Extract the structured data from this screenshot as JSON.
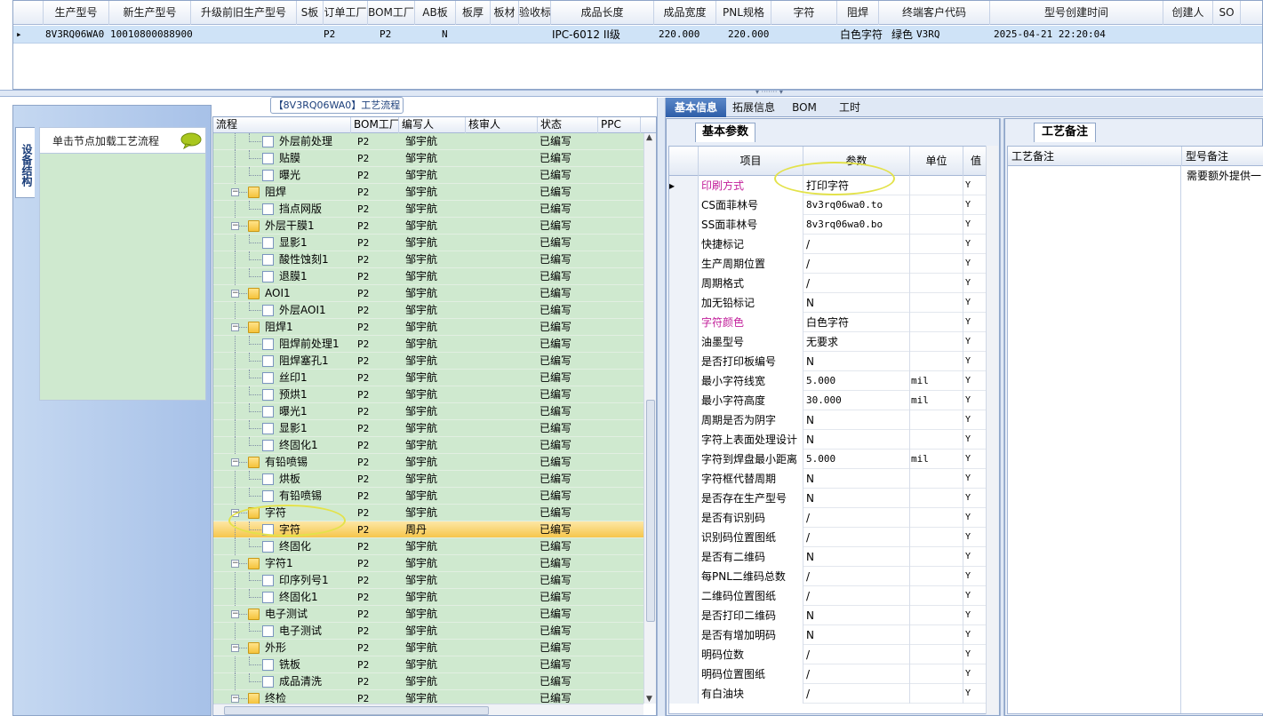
{
  "top_grid": {
    "headers": [
      "生产型号",
      "新生产型号",
      "升级前旧生产型号",
      "S板",
      "订单工厂",
      "BOM工厂",
      "AB板",
      "板厚",
      "板材",
      "验收标准",
      "成品长度",
      "成品宽度",
      "PNL规格",
      "字符",
      "阻焊",
      "终端客户代码",
      "型号创建时间",
      "创建人",
      "SO"
    ],
    "row": {
      "pointer": "▸",
      "model": "8V3RQ06WA0",
      "new_model": "10010800088900",
      "order_factory": "P2",
      "bom_factory": "P2",
      "ab_board": "N",
      "standard": "IPC-6012 II级",
      "length": "220.000",
      "width": "220.000",
      "char": "白色字符",
      "solder": "绿色",
      "customer": "V3RQ",
      "created": "2025-04-21 22:20:04"
    }
  },
  "left_panel": {
    "vertical_tab": "设备结构",
    "hint": "单击节点加载工艺流程"
  },
  "flow": {
    "title": "【8V3RQ06WA0】工艺流程",
    "headers": [
      "流程",
      "BOM工厂",
      "编写人",
      "核审人",
      "状态",
      "PPC"
    ],
    "rows": [
      {
        "level": 2,
        "type": "doc",
        "name": "外层前处理",
        "bom": "P2",
        "writer": "邹宇航",
        "status": "已编写"
      },
      {
        "level": 2,
        "type": "doc",
        "name": "贴膜",
        "bom": "P2",
        "writer": "邹宇航",
        "status": "已编写"
      },
      {
        "level": 2,
        "type": "doc",
        "name": "曝光",
        "bom": "P2",
        "writer": "邹宇航",
        "status": "已编写"
      },
      {
        "level": 1,
        "type": "folder",
        "name": "阻焊",
        "bom": "P2",
        "writer": "邹宇航",
        "status": "已编写"
      },
      {
        "level": 2,
        "type": "doc",
        "name": "挡点网版",
        "bom": "P2",
        "writer": "邹宇航",
        "status": "已编写"
      },
      {
        "level": 1,
        "type": "folder",
        "name": "外层干膜1",
        "bom": "P2",
        "writer": "邹宇航",
        "status": "已编写"
      },
      {
        "level": 2,
        "type": "doc",
        "name": "显影1",
        "bom": "P2",
        "writer": "邹宇航",
        "status": "已编写"
      },
      {
        "level": 2,
        "type": "doc",
        "name": "酸性蚀刻1",
        "bom": "P2",
        "writer": "邹宇航",
        "status": "已编写"
      },
      {
        "level": 2,
        "type": "doc",
        "name": "退膜1",
        "bom": "P2",
        "writer": "邹宇航",
        "status": "已编写"
      },
      {
        "level": 1,
        "type": "folder",
        "name": "AOI1",
        "bom": "P2",
        "writer": "邹宇航",
        "status": "已编写"
      },
      {
        "level": 2,
        "type": "doc",
        "name": "外层AOI1",
        "bom": "P2",
        "writer": "邹宇航",
        "status": "已编写"
      },
      {
        "level": 1,
        "type": "folder",
        "name": "阻焊1",
        "bom": "P2",
        "writer": "邹宇航",
        "status": "已编写"
      },
      {
        "level": 2,
        "type": "doc",
        "name": "阻焊前处理1",
        "bom": "P2",
        "writer": "邹宇航",
        "status": "已编写"
      },
      {
        "level": 2,
        "type": "doc",
        "name": "阻焊塞孔1",
        "bom": "P2",
        "writer": "邹宇航",
        "status": "已编写"
      },
      {
        "level": 2,
        "type": "doc",
        "name": "丝印1",
        "bom": "P2",
        "writer": "邹宇航",
        "status": "已编写"
      },
      {
        "level": 2,
        "type": "doc",
        "name": "预烘1",
        "bom": "P2",
        "writer": "邹宇航",
        "status": "已编写"
      },
      {
        "level": 2,
        "type": "doc",
        "name": "曝光1",
        "bom": "P2",
        "writer": "邹宇航",
        "status": "已编写"
      },
      {
        "level": 2,
        "type": "doc",
        "name": "显影1",
        "bom": "P2",
        "writer": "邹宇航",
        "status": "已编写"
      },
      {
        "level": 2,
        "type": "doc",
        "name": "终固化1",
        "bom": "P2",
        "writer": "邹宇航",
        "status": "已编写"
      },
      {
        "level": 1,
        "type": "folder",
        "name": "有铅喷锡",
        "bom": "P2",
        "writer": "邹宇航",
        "status": "已编写"
      },
      {
        "level": 2,
        "type": "doc",
        "name": "烘板",
        "bom": "P2",
        "writer": "邹宇航",
        "status": "已编写"
      },
      {
        "level": 2,
        "type": "doc",
        "name": "有铅喷锡",
        "bom": "P2",
        "writer": "邹宇航",
        "status": "已编写"
      },
      {
        "level": 1,
        "type": "folder",
        "name": "字符",
        "bom": "P2",
        "writer": "邹宇航",
        "status": "已编写"
      },
      {
        "level": 2,
        "type": "doc",
        "name": "字符",
        "bom": "P2",
        "writer": "周丹",
        "status": "已编写",
        "selected": true
      },
      {
        "level": 2,
        "type": "doc",
        "name": "终固化",
        "bom": "P2",
        "writer": "邹宇航",
        "status": "已编写"
      },
      {
        "level": 1,
        "type": "folder",
        "name": "字符1",
        "bom": "P2",
        "writer": "邹宇航",
        "status": "已编写"
      },
      {
        "level": 2,
        "type": "doc",
        "name": "印序列号1",
        "bom": "P2",
        "writer": "邹宇航",
        "status": "已编写"
      },
      {
        "level": 2,
        "type": "doc",
        "name": "终固化1",
        "bom": "P2",
        "writer": "邹宇航",
        "status": "已编写"
      },
      {
        "level": 1,
        "type": "folder",
        "name": "电子测试",
        "bom": "P2",
        "writer": "邹宇航",
        "status": "已编写"
      },
      {
        "level": 2,
        "type": "doc",
        "name": "电子测试",
        "bom": "P2",
        "writer": "邹宇航",
        "status": "已编写"
      },
      {
        "level": 1,
        "type": "folder",
        "name": "外形",
        "bom": "P2",
        "writer": "邹宇航",
        "status": "已编写"
      },
      {
        "level": 2,
        "type": "doc",
        "name": "铣板",
        "bom": "P2",
        "writer": "邹宇航",
        "status": "已编写"
      },
      {
        "level": 2,
        "type": "doc",
        "name": "成品清洗",
        "bom": "P2",
        "writer": "邹宇航",
        "status": "已编写"
      },
      {
        "level": 1,
        "type": "folder",
        "name": "终检",
        "bom": "P2",
        "writer": "邹宇航",
        "status": "已编写"
      }
    ]
  },
  "right_tabs": [
    "基本信息",
    "拓展信息",
    "BOM",
    "工时"
  ],
  "params": {
    "tab": "基本参数",
    "headers": [
      "项目",
      "参数",
      "单位",
      "值"
    ],
    "rows": [
      {
        "item": "印刷方式",
        "value": "打印字符",
        "unit": "",
        "flag": "Y",
        "magenta": true,
        "current": true
      },
      {
        "item": "CS面菲林号",
        "value": "8v3rq06wa0.to",
        "unit": "",
        "flag": "Y",
        "mono": true
      },
      {
        "item": "SS面菲林号",
        "value": "8v3rq06wa0.bo",
        "unit": "",
        "flag": "Y",
        "mono": true
      },
      {
        "item": "快捷标记",
        "value": "/",
        "unit": "",
        "flag": "Y"
      },
      {
        "item": "生产周期位置",
        "value": "/",
        "unit": "",
        "flag": "Y"
      },
      {
        "item": "周期格式",
        "value": "/",
        "unit": "",
        "flag": "Y"
      },
      {
        "item": "加无铅标记",
        "value": "N",
        "unit": "",
        "flag": "Y"
      },
      {
        "item": "字符颜色",
        "value": "白色字符",
        "unit": "",
        "flag": "Y",
        "magenta": true
      },
      {
        "item": "油墨型号",
        "value": "无要求",
        "unit": "",
        "flag": "Y"
      },
      {
        "item": "是否打印板编号",
        "value": "N",
        "unit": "",
        "flag": "Y"
      },
      {
        "item": "最小字符线宽",
        "value": "5.000",
        "unit": "mil",
        "flag": "Y",
        "mono": true
      },
      {
        "item": "最小字符高度",
        "value": "30.000",
        "unit": "mil",
        "flag": "Y",
        "mono": true
      },
      {
        "item": "周期是否为阴字",
        "value": "N",
        "unit": "",
        "flag": "Y"
      },
      {
        "item": "字符上表面处理设计",
        "value": "N",
        "unit": "",
        "flag": "Y"
      },
      {
        "item": "字符到焊盘最小距离",
        "value": "5.000",
        "unit": "mil",
        "flag": "Y",
        "mono": true
      },
      {
        "item": "字符框代替周期",
        "value": "N",
        "unit": "",
        "flag": "Y"
      },
      {
        "item": "是否存在生产型号",
        "value": "N",
        "unit": "",
        "flag": "Y"
      },
      {
        "item": "是否有识别码",
        "value": "/",
        "unit": "",
        "flag": "Y"
      },
      {
        "item": "识别码位置图纸",
        "value": "/",
        "unit": "",
        "flag": "Y"
      },
      {
        "item": "是否有二维码",
        "value": "N",
        "unit": "",
        "flag": "Y"
      },
      {
        "item": "每PNL二维码总数",
        "value": "/",
        "unit": "",
        "flag": "Y"
      },
      {
        "item": "二维码位置图纸",
        "value": "/",
        "unit": "",
        "flag": "Y"
      },
      {
        "item": "是否打印二维码",
        "value": "N",
        "unit": "",
        "flag": "Y"
      },
      {
        "item": "是否有增加明码",
        "value": "N",
        "unit": "",
        "flag": "Y"
      },
      {
        "item": "明码位数",
        "value": "/",
        "unit": "",
        "flag": "Y"
      },
      {
        "item": "明码位置图纸",
        "value": "/",
        "unit": "",
        "flag": "Y"
      },
      {
        "item": "有白油块",
        "value": "/",
        "unit": "",
        "flag": "Y"
      }
    ]
  },
  "notes": {
    "tab": "工艺备注",
    "headers": [
      "工艺备注",
      "型号备注"
    ],
    "model_note": "需要额外提供一"
  },
  "colors": {
    "tree_bg": "#cfe9cf",
    "selected_row": "#f6c64c",
    "accent": "#2e5ea8",
    "magenta": "#c21e9a",
    "highlight": "#e3e24a"
  }
}
